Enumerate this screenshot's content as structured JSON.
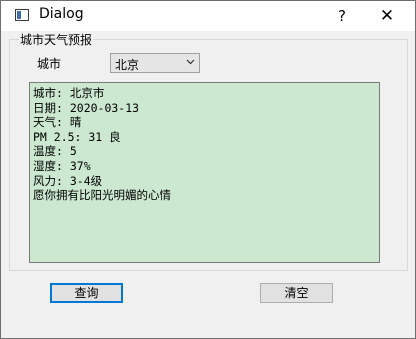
{
  "window": {
    "title": "Dialog",
    "help_label": "?",
    "close_label": "✕"
  },
  "group": {
    "title": "城市天气预报"
  },
  "city": {
    "label": "城市",
    "selected": "北京"
  },
  "report": {
    "lines": [
      "城市: 北京市",
      "日期: 2020-03-13",
      "天气: 晴",
      "PM 2.5: 31 良",
      "温度: 5",
      "湿度: 37%",
      "风力: 3-4级",
      "",
      "愿你拥有比阳光明媚的心情"
    ]
  },
  "buttons": {
    "query_label": "查询",
    "clear_label": "清空"
  },
  "colors": {
    "report_bg": "#cce8d0",
    "focus_border": "#0078d7"
  },
  "icons": {
    "combo": "chevron-down-icon",
    "app": "window-icon"
  }
}
